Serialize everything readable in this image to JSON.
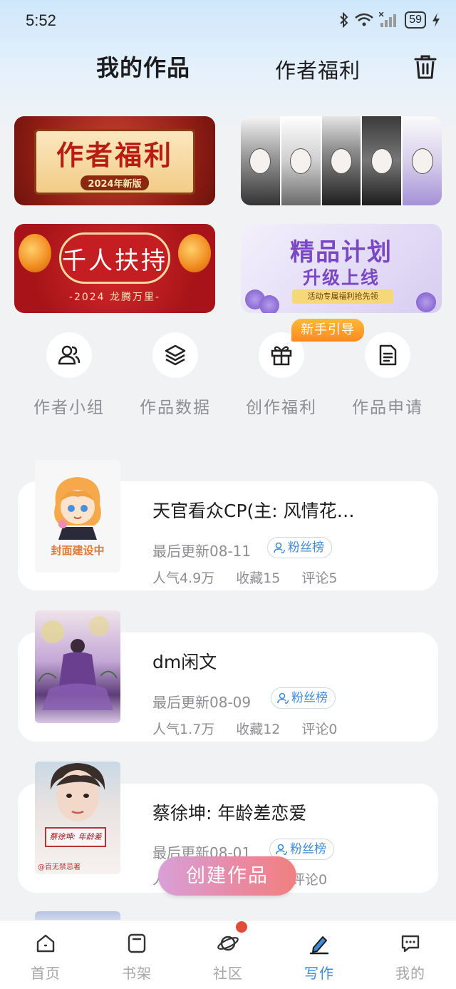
{
  "status_bar": {
    "time": "5:52",
    "battery": "59"
  },
  "header": {
    "title": "我的作品",
    "welfare_tab": "作者福利"
  },
  "banners": {
    "banner1": {
      "title": "作者福利",
      "subtitle": "2024年新版"
    },
    "banner3": {
      "title": "千人扶持",
      "subtitle": "-2024 龙腾万里-"
    },
    "banner4": {
      "title": "精品计划",
      "subtitle": "升级上线",
      "note": "活动专属福利抢先领"
    }
  },
  "quick_actions": {
    "badge": "新手引导",
    "items": [
      {
        "label": "作者小组",
        "icon": "people-icon"
      },
      {
        "label": "作品数据",
        "icon": "layers-icon"
      },
      {
        "label": "创作福利",
        "icon": "gift-icon"
      },
      {
        "label": "作品申请",
        "icon": "document-icon"
      }
    ]
  },
  "works": [
    {
      "title": "天官看众CP(主: 风情花…",
      "updated": "最后更新08-11",
      "fans": "粉丝榜",
      "popularity": "人气4.9万",
      "favorites": "收藏15",
      "comments": "评论5",
      "cover_text": "封面建设中"
    },
    {
      "title": "dm闲文",
      "updated": "最后更新08-09",
      "fans": "粉丝榜",
      "popularity": "人气1.7万",
      "favorites": "收藏12",
      "comments": "评论0"
    },
    {
      "title": "蔡徐坤: 年龄差恋爱",
      "updated": "最后更新08-01",
      "fans": "粉丝榜",
      "popularity": "人",
      "favorites": "",
      "comments": "评论0",
      "cover_sign": "蔡徐坤: 年龄差",
      "cover_watermark": "@百无禁忌著"
    }
  ],
  "create_button": "创建作品",
  "bottom_nav": [
    {
      "label": "首页",
      "icon": "home-icon"
    },
    {
      "label": "书架",
      "icon": "bookshelf-icon"
    },
    {
      "label": "社区",
      "icon": "planet-icon"
    },
    {
      "label": "写作",
      "icon": "pen-icon",
      "active": true
    },
    {
      "label": "我的",
      "icon": "chat-icon"
    }
  ],
  "colors": {
    "accent": "#3d8bd9",
    "badge": "#ff9a24",
    "notification": "#e24a3b"
  }
}
